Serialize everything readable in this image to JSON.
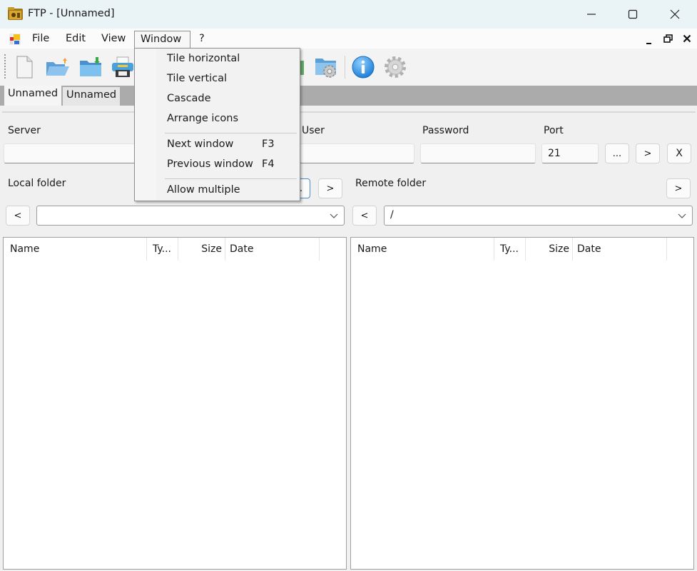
{
  "window": {
    "title": "FTP - [Unnamed]",
    "controls": {
      "minimize": "minimize",
      "maximize": "maximize",
      "close": "close"
    }
  },
  "menubar": {
    "items": [
      "File",
      "Edit",
      "View",
      "Window",
      "?"
    ],
    "active": "Window"
  },
  "mdi_controls": {
    "minimize": "_",
    "restore": "restore",
    "close": "x"
  },
  "toolbar": {
    "buttons": [
      {
        "name": "new",
        "icon": "new-document-icon"
      },
      {
        "name": "open",
        "icon": "open-folder-icon"
      },
      {
        "name": "save",
        "icon": "save-folder-icon"
      },
      {
        "name": "print",
        "icon": "printer-icon"
      },
      {
        "name": "hidden",
        "icon": "hidden-toolbar-icon"
      },
      {
        "name": "folder-settings",
        "icon": "folder-settings-icon"
      },
      {
        "name": "about",
        "icon": "info-icon"
      },
      {
        "name": "settings",
        "icon": "gear-icon"
      }
    ]
  },
  "doc_tabs": [
    {
      "label": "Unnamed",
      "active": true
    },
    {
      "label": "Unnamed",
      "active": false
    }
  ],
  "connection": {
    "server_label": "Server",
    "server_value": "",
    "user_label": "User",
    "user_value": "",
    "password_label": "Password",
    "password_value": "",
    "port_label": "Port",
    "port_value": "21",
    "browse_button": "...",
    "connect_button": ">",
    "disconnect_button": "X"
  },
  "local": {
    "label": "Local folder",
    "back_button": "<",
    "browse_button": "...",
    "go_button": ">",
    "path_value": "",
    "columns": [
      "Name",
      "Ty...",
      "Size",
      "Date"
    ],
    "rows": []
  },
  "remote": {
    "label": "Remote folder",
    "back_button": "<",
    "go_button": ">",
    "path_value": "/",
    "columns": [
      "Name",
      "Ty...",
      "Size",
      "Date"
    ],
    "rows": []
  },
  "window_menu": {
    "items": [
      {
        "label": "Tile horizontal",
        "shortcut": ""
      },
      {
        "label": "Tile vertical",
        "shortcut": ""
      },
      {
        "label": "Cascade",
        "shortcut": ""
      },
      {
        "label": "Arrange icons",
        "shortcut": ""
      },
      {
        "label": "Next window",
        "shortcut": "F3"
      },
      {
        "label": "Previous window",
        "shortcut": "F4"
      },
      {
        "label": "Allow multiple",
        "shortcut": ""
      }
    ]
  },
  "colors": {
    "titlebar_bg": "#eaf3f6",
    "tabstrip_bg": "#ababab",
    "info_blue": "#2a8fe0",
    "focus_blue": "#4a8ac8"
  }
}
